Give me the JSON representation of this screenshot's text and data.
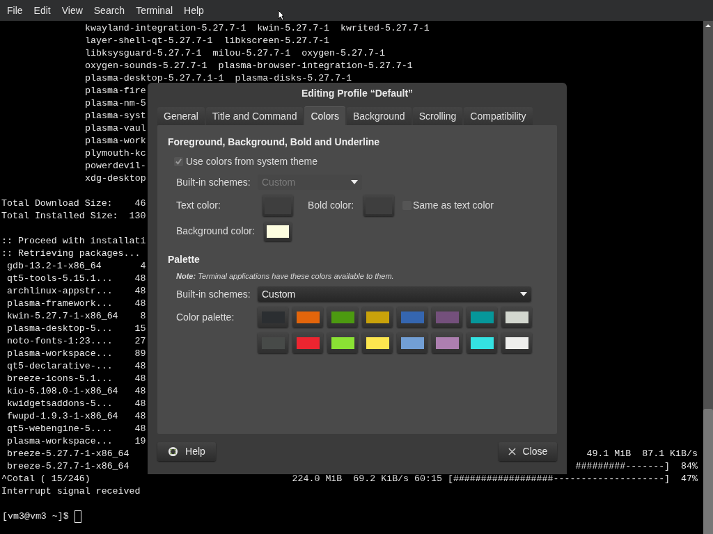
{
  "menu_bar": [
    "File",
    "Edit",
    "View",
    "Search",
    "Terminal",
    "Help"
  ],
  "terminal": {
    "rows": [
      {
        "kind": "package-list",
        "text": "kwayland-integration-5.27.7-1  kwin-5.27.7-1  kwrited-5.27.7-1"
      },
      {
        "kind": "package-list",
        "text": "layer-shell-qt-5.27.7-1  libkscreen-5.27.7-1"
      },
      {
        "kind": "package-list",
        "text": "libksysguard-5.27.7-1  milou-5.27.7-1  oxygen-5.27.7-1"
      },
      {
        "kind": "package-list",
        "text": "oxygen-sounds-5.27.7-1  plasma-browser-integration-5.27.7-1"
      },
      {
        "kind": "package-list",
        "text": "plasma-desktop-5.27.7.1-1  plasma-disks-5.27.7-1"
      },
      {
        "kind": "package-list",
        "text": "plasma-fire"
      },
      {
        "kind": "package-list",
        "text": "plasma-nm-5"
      },
      {
        "kind": "package-list",
        "text": "plasma-syst"
      },
      {
        "kind": "package-list",
        "text": "plasma-vaul"
      },
      {
        "kind": "package-list",
        "text": "plasma-work"
      },
      {
        "kind": "package-list",
        "text": "plymouth-kc"
      },
      {
        "kind": "package-list",
        "text": "powerdevil-"
      },
      {
        "kind": "package-list",
        "text": "xdg-desktop"
      },
      {
        "kind": "blank"
      },
      {
        "kind": "plain",
        "text": "Total Download Size:    46"
      },
      {
        "kind": "plain",
        "text": "Total Installed Size:  130"
      },
      {
        "kind": "blank"
      },
      {
        "kind": "plain",
        "text": ":: Proceed with installati"
      },
      {
        "kind": "plain",
        "text": ":: Retrieving packages..."
      },
      {
        "kind": "download",
        "text": "gdb-13.2-1-x86_64       4"
      },
      {
        "kind": "download",
        "text": "qt5-tools-5.15.1...    48"
      },
      {
        "kind": "download",
        "text": "archlinux-appstr...    48"
      },
      {
        "kind": "download",
        "text": "plasma-framework...    48"
      },
      {
        "kind": "download",
        "text": "kwin-5.27.7-1-x86_64    8"
      },
      {
        "kind": "download",
        "text": "plasma-desktop-5...    15"
      },
      {
        "kind": "download",
        "text": "noto-fonts-1:23....    27"
      },
      {
        "kind": "download",
        "text": "plasma-workspace...    89"
      },
      {
        "kind": "download",
        "text": "qt5-declarative-...    48"
      },
      {
        "kind": "download",
        "text": "breeze-icons-5.1...    48"
      },
      {
        "kind": "download",
        "text": "kio-5.108.0-1-x86_64   48"
      },
      {
        "kind": "download",
        "text": "kwidgetsaddons-5...    48"
      },
      {
        "kind": "download",
        "text": "fwupd-1.9.3-1-x86_64   48"
      },
      {
        "kind": "download",
        "text": "qt5-webengine-5....    48"
      },
      {
        "kind": "download",
        "text": "plasma-workspace...    19"
      },
      {
        "kind": "download",
        "text": "breeze-5.27.7-1-x86_64",
        "right": "49.1 MiB  87.1 KiB/s"
      },
      {
        "kind": "download",
        "text": "breeze-5.27.7-1-x86_64",
        "right": "#########-------]  84%"
      },
      {
        "kind": "plain",
        "text": "^Cotal ( 15/246)",
        "right": "224.0 MiB  69.2 KiB/s 60:15 [##################--------------------]  47%"
      },
      {
        "kind": "plain",
        "text": "Interrupt signal received"
      },
      {
        "kind": "blank"
      },
      {
        "kind": "prompt",
        "text": "[vm3@vm3 ~]$"
      }
    ]
  },
  "dialog": {
    "title": "Editing Profile “Default”",
    "tabs": [
      {
        "label": "General",
        "selected": false
      },
      {
        "label": "Title and Command",
        "selected": false
      },
      {
        "label": "Colors",
        "selected": true
      },
      {
        "label": "Background",
        "selected": false
      },
      {
        "label": "Scrolling",
        "selected": false
      },
      {
        "label": "Compatibility",
        "selected": false
      }
    ],
    "foreground_section": {
      "heading": "Foreground, Background, Bold and Underline",
      "use_system_colors": {
        "label": "Use colors from system theme",
        "checked": true
      },
      "builtin_schemes": {
        "label": "Built-in schemes:",
        "value": "Custom",
        "disabled": true
      },
      "text_color": {
        "label": "Text color:",
        "color": "#3e3e3e"
      },
      "bold_color": {
        "label": "Bold color:",
        "color": "#3e3e3e"
      },
      "same_as_text": {
        "label": "Same as text color",
        "checked": false
      },
      "background_color": {
        "label": "Background color:",
        "color": "#fdfde0"
      }
    },
    "palette_section": {
      "heading": "Palette",
      "note": "**Note:** Terminal applications have these colors available to them.",
      "builtin_schemes": {
        "label": "Built-in schemes:",
        "value": "Custom",
        "disabled": false
      },
      "palette_label": "Color palette:",
      "swatches": [
        {
          "color": "#2b2e31"
        },
        {
          "color": "#e3650b"
        },
        {
          "color": "#4c9a10"
        },
        {
          "color": "#c9a20a"
        },
        {
          "color": "#3566b0"
        },
        {
          "color": "#74507c"
        },
        {
          "color": "#06979a"
        },
        {
          "color": "#d3d7cf"
        },
        {
          "color": "#474a48"
        },
        {
          "color": "#ec2530"
        },
        {
          "color": "#8ae234"
        },
        {
          "color": "#fce64f"
        },
        {
          "color": "#729fd5"
        },
        {
          "color": "#ad7fb0"
        },
        {
          "color": "#34e2e2"
        },
        {
          "color": "#eeeeec"
        }
      ]
    },
    "buttons": [
      {
        "kind": "help",
        "label": "Help"
      },
      {
        "kind": "close",
        "label": "Close"
      }
    ]
  }
}
